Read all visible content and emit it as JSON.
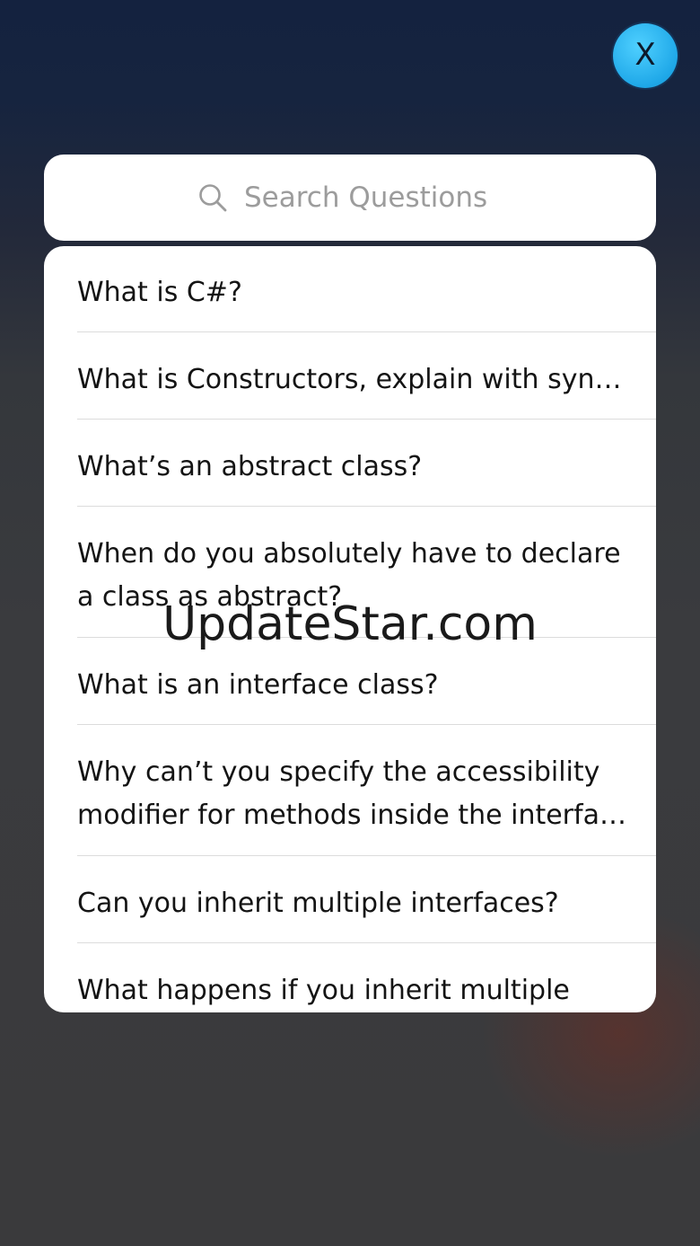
{
  "close_button": {
    "label": "X",
    "color": "#29b6f2"
  },
  "search": {
    "placeholder": "Search Questions",
    "value": ""
  },
  "questions": [
    "What is C#?",
    "What is Constructors, explain with syn…",
    "What’s an abstract class?",
    "When do you absolutely have to declare a class as abstract?",
    "What is an interface class?",
    "Why can’t you specify the accessibility modifier for methods inside the interfa…",
    "Can you inherit multiple interfaces?",
    "What happens if you inherit multiple"
  ],
  "watermark": "UpdateStar.com"
}
